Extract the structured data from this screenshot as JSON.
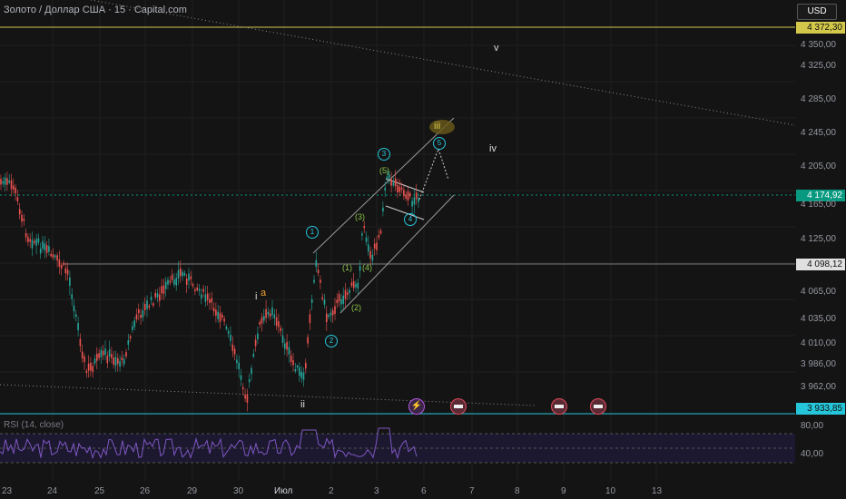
{
  "header": {
    "title": "Золото / Доллар США · 15 · Capital.com",
    "currency": "USD"
  },
  "price_axis": {
    "ticks": [
      "4 350,00",
      "4 325,00",
      "4 285,00",
      "4 245,00",
      "4 205,00",
      "4 165,00",
      "4 125,00",
      "4 065,00",
      "4 035,00",
      "4 010,00",
      "3 986,00",
      "3 962,00"
    ],
    "labels": {
      "resistance": "4 372,30",
      "current": "4 174,92",
      "level": "4 098,12",
      "support": "3 933,85"
    }
  },
  "rsi_axis": {
    "ticks": [
      "80,00",
      "40,00"
    ]
  },
  "time_axis": {
    "ticks": [
      "23",
      "24",
      "25",
      "26",
      "29",
      "30",
      "Июл",
      "2",
      "3",
      "6",
      "7",
      "8",
      "9",
      "10",
      "13"
    ]
  },
  "indicator": {
    "label": "RSI (14, close)"
  },
  "wave_labels": {
    "v": "v",
    "iv": "iv",
    "iii": "iii",
    "ii": "ii",
    "i": "i",
    "a": "a",
    "c1": "1",
    "c2": "2",
    "c3": "3",
    "c4": "4",
    "c5": "5",
    "p1": "(1)",
    "p2": "(2)",
    "p3": "(3)",
    "p4": "(4)",
    "p5": "(5)"
  },
  "colors": {
    "bull": "#26a69a",
    "bear": "#ef5350",
    "resistance_line": "#d4c84a",
    "support_line": "#26c6da",
    "current_price": "#089981",
    "rsi_line": "#7e57c2"
  }
}
